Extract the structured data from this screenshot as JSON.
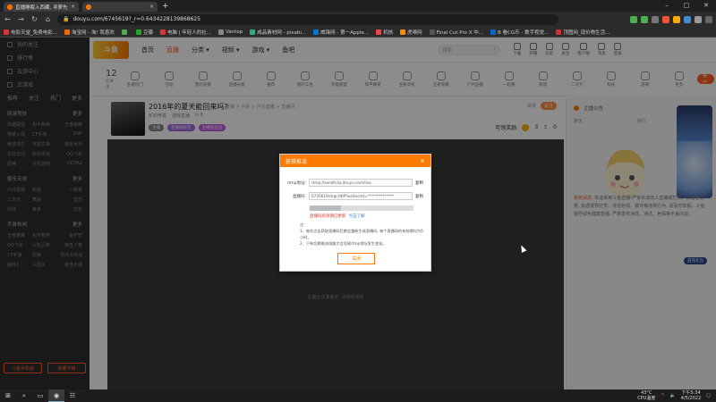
{
  "browser": {
    "tabs": [
      {
        "title": "直播睡眠入西藏, 寻萝先体直播间",
        "active": true
      },
      {
        "title": "",
        "active": false
      }
    ],
    "new_tab": "+",
    "url": "douyu.com/6745619?_r=0.6434228139868625",
    "bookmarks": [
      {
        "label": "电影天堂_免费电影...",
        "color": "#d33"
      },
      {
        "label": "淘宝网 - 淘! 我喜欢",
        "color": "#f60"
      },
      {
        "label": "",
        "color": "#5a5"
      },
      {
        "label": "豆瓣",
        "color": "#2a2"
      },
      {
        "label": "电脑 | 年轻人的社...",
        "color": "#d33"
      },
      {
        "label": "Vantop",
        "color": "#888"
      },
      {
        "label": "成品素材网 - pixabi...",
        "color": "#3a8"
      },
      {
        "label": "威锋网 - 第一Apple...",
        "color": "#07c"
      },
      {
        "label": "机核",
        "color": "#e44"
      },
      {
        "label": "虎嗅网",
        "color": "#f80"
      },
      {
        "label": "Final Cut Pro X 中...",
        "color": "#555"
      },
      {
        "label": "B 看CG乐 - 数字视觉...",
        "color": "#06c"
      },
      {
        "label": "顶图网_现价物生活...",
        "color": "#c33"
      }
    ]
  },
  "site": {
    "logo": "斗鱼",
    "nav": [
      {
        "label": "首页",
        "active": false
      },
      {
        "label": "直播",
        "active": true
      },
      {
        "label": "分类 ▾",
        "active": false
      },
      {
        "label": "视频 ▾",
        "active": false
      },
      {
        "label": "游戏 ▾",
        "active": false
      },
      {
        "label": "鱼吧",
        "active": false
      }
    ],
    "search_placeholder": "搜索",
    "header_icons": [
      "下载",
      "开播",
      "历史",
      "关注",
      "客户端",
      "消息",
      "登录"
    ]
  },
  "sidebar": {
    "items": [
      "我的关注",
      "排行榜",
      "云游中心",
      "正游戏"
    ],
    "follow_icons": [
      "推荐",
      "关注",
      "热门",
      "更多"
    ],
    "sections": [
      {
        "title": "网游竞技",
        "more": "更多",
        "grid": [
          "英雄联盟",
          "和平精英",
          "王者荣耀",
          "穿越火线",
          "CF手游",
          "DNF",
          "绝地求生",
          "守望先锋",
          "魔兽世界",
          "永劫无间",
          "炉石传说",
          "QQ飞车",
          "原神",
          "主机游戏",
          "DOTA2"
        ]
      },
      {
        "title": "娱乐天地",
        "more": "更多",
        "grid": [
          "户外直播",
          "颜值",
          "一起看",
          "二次元",
          "舞蹈",
          "音乐",
          "科技",
          "美食",
          "交友"
        ]
      },
      {
        "title": "手游休闲",
        "more": "更多",
        "grid": [
          "王者荣耀",
          "和平精英",
          "金铲铲",
          "QQ飞车",
          "火影忍者",
          "第五人格",
          "CF手游",
          "原神",
          "球球大作战",
          "崩坏3",
          "三国杀",
          "其他手游"
        ]
      }
    ],
    "bottom_buttons": [
      "斗鱼手机版",
      "我要开播"
    ]
  },
  "categories": {
    "counter_value": "12",
    "counter_label": "已关注",
    "items": [
      "鱼塘热门",
      "活动",
      "我的竞猜",
      "直播分类",
      "推荐",
      "我的工会",
      "英雄联盟",
      "和平精英",
      "主机单机",
      "王者荣耀",
      "户外直播",
      "一起看",
      "颜值",
      "二次元",
      "科技",
      "游戏",
      "更多"
    ],
    "pc_button": "PC客户端"
  },
  "room": {
    "title": "2016年的夏天能回来吗?",
    "subtitle_prefix": "炉石传说",
    "breadcrumb": "直播 > 户外 > 户外直播 > 直播间",
    "owner": "游戏直播",
    "level": "lv.8",
    "tags": [
      {
        "label": "主播",
        "color": "#888"
      },
      {
        "label": "直播间标签",
        "color": "#a466e0"
      },
      {
        "label": "主播粉丝团",
        "color": "#c45ae0"
      }
    ],
    "right_link": "举报",
    "right_tag": "关注",
    "fans_label": "可领奖励",
    "fans_value": "3",
    "viewers": "0"
  },
  "video": {
    "footer_text": "主播正在准备中, 请稍后观看"
  },
  "chat": {
    "header": "主播公告",
    "tabs": [
      "聊天",
      "排行",
      "贵宾"
    ],
    "badge_btn": "首充礼包",
    "system_label": "系统消息:",
    "system_text": "欢迎来到斗鱼直播!严禁未成年人直播或打赏。请理性消费, 如遇诱导打赏、低俗色情、欺诈等违规行为, 请及时举报。斗鱼倡导绿色健康直播, 严禁发布涉政、违法、色情等不良内容。"
  },
  "dialog": {
    "title": "获得推流",
    "close": "×",
    "rtmp_label": "rtmp地址:",
    "rtmp_value": "rtmp://sendfc3a.douyu.com/live",
    "rtmp_copy": "复制",
    "key_label": "直播码:",
    "key_value": "6745619rdrgcHtlP?wsSecret=**************",
    "key_copy": "复制",
    "warning": "直播码有效期已更新",
    "warning_link": "点击了解",
    "notes": [
      "注:",
      "1、每次点击获取直播码后都会重新生成直播码, 每个直播码的有效期均为6小时。",
      "2、只有切换推流线路才会导致rtmp地址发生变化。"
    ],
    "ok": "关闭"
  },
  "taskbar": {
    "icons": [
      "⊞",
      "⌕",
      "▭",
      "◉",
      "☷"
    ],
    "weather_temp": "43°C",
    "weather_label": "CPU温度",
    "time": "下午5:34",
    "date": "4/5/2022"
  }
}
